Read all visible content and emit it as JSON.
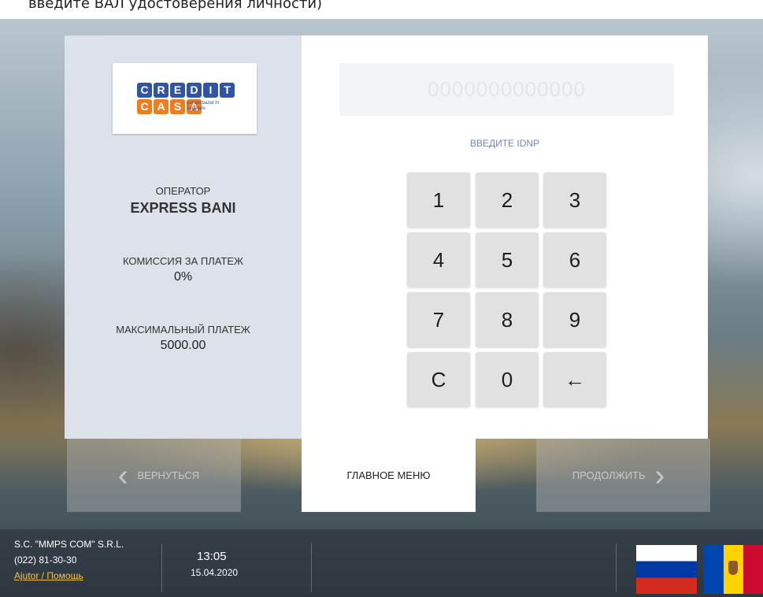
{
  "top_caption": "введите ВАЛ удостоверения личности)",
  "logo": {
    "row1": [
      "C",
      "R",
      "E",
      "D",
      "I",
      "T"
    ],
    "row2": [
      "C",
      "A",
      "S",
      "A"
    ],
    "tagline": "parajul bazat în bugetare"
  },
  "info": {
    "operator_label": "ОПЕРАТОР",
    "operator_value": "EXPRESS BANI",
    "commission_label": "КОМИССИЯ ЗА ПЛАТЕЖ",
    "commission_value": "0%",
    "max_label": "МАКСИМАЛЬНЫЙ ПЛАТЕЖ",
    "max_value": "5000.00"
  },
  "idnp": {
    "placeholder": "0000000000000",
    "value": "",
    "hint": "ВВЕДИТЕ IDNP"
  },
  "keypad": {
    "keys": [
      "1",
      "2",
      "3",
      "4",
      "5",
      "6",
      "7",
      "8",
      "9",
      "C",
      "0",
      "←"
    ]
  },
  "nav": {
    "back_label": "ВЕРНУТЬСЯ",
    "main_menu_label": "ГЛАВНОЕ МЕНЮ",
    "continue_label": "ПРОДОЛЖИТЬ",
    "back_chevron": "‹",
    "continue_chevron": "›"
  },
  "footer": {
    "company": "S.C. \"MMPS COM\" S.R.L.",
    "phone": "(022) 81-30-30",
    "help": "Ajutor / Помощь",
    "time": "13:05",
    "date": "15.04.2020"
  },
  "colors": {
    "left_panel_bg": "#dde2ea",
    "hint_color": "#6f86c7",
    "logo_blue": "#2f55a4",
    "logo_orange": "#ee7d22"
  },
  "languages": [
    "ru",
    "md"
  ]
}
